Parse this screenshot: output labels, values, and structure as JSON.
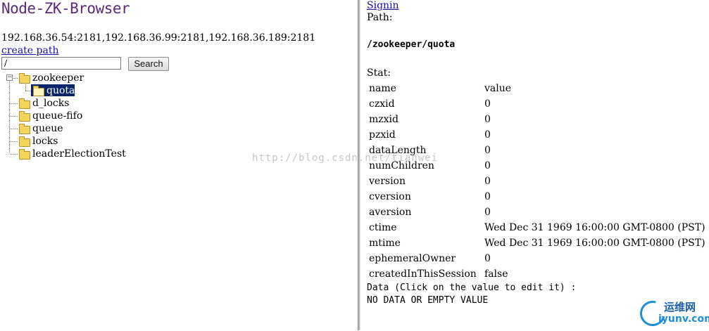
{
  "left": {
    "app_title": "Node-ZK-Browser",
    "servers": "192.168.36.54:2181,192.168.36.99:2181,192.168.36.189:2181",
    "create_path_link": "create path",
    "search": {
      "value": "/",
      "button_label": "Search"
    },
    "tree": {
      "root": {
        "label": "zookeeper",
        "expanded": true,
        "children": [
          {
            "label": "quota",
            "selected": true
          }
        ]
      },
      "siblings": [
        "d_locks",
        "queue-fifo",
        "queue",
        "locks",
        "leaderElectionTest"
      ]
    }
  },
  "watermark": "http://blog.csdn.net/tianwei",
  "right": {
    "signin": "Signin",
    "path_label": "Path:",
    "path_value": "/zookeeper/quota",
    "stat_label": "Stat:",
    "stats": [
      {
        "key": "name",
        "value": "value"
      },
      {
        "key": "czxid",
        "value": "0"
      },
      {
        "key": "mzxid",
        "value": "0"
      },
      {
        "key": "pzxid",
        "value": "0"
      },
      {
        "key": "dataLength",
        "value": "0"
      },
      {
        "key": "numChildren",
        "value": "0"
      },
      {
        "key": "version",
        "value": "0"
      },
      {
        "key": "cversion",
        "value": "0"
      },
      {
        "key": "aversion",
        "value": "0"
      },
      {
        "key": "ctime",
        "value": "Wed Dec 31 1969 16:00:00 GMT-0800 (PST)"
      },
      {
        "key": "mtime",
        "value": "Wed Dec 31 1969 16:00:00 GMT-0800 (PST)"
      },
      {
        "key": "ephemeralOwner",
        "value": "0"
      },
      {
        "key": "createdInThisSession",
        "value": "false"
      }
    ],
    "data_label": "Data (Click on the value to edit it) :",
    "data_value": "NO DATA OR EMPTY VALUE"
  },
  "logo": {
    "line1": "运维网",
    "line2": "iyunv.com"
  },
  "colors": {
    "title": "#5b2a7c",
    "link": "#1a0dab",
    "selection": "#0a246a",
    "folder": "#f2d45c"
  }
}
